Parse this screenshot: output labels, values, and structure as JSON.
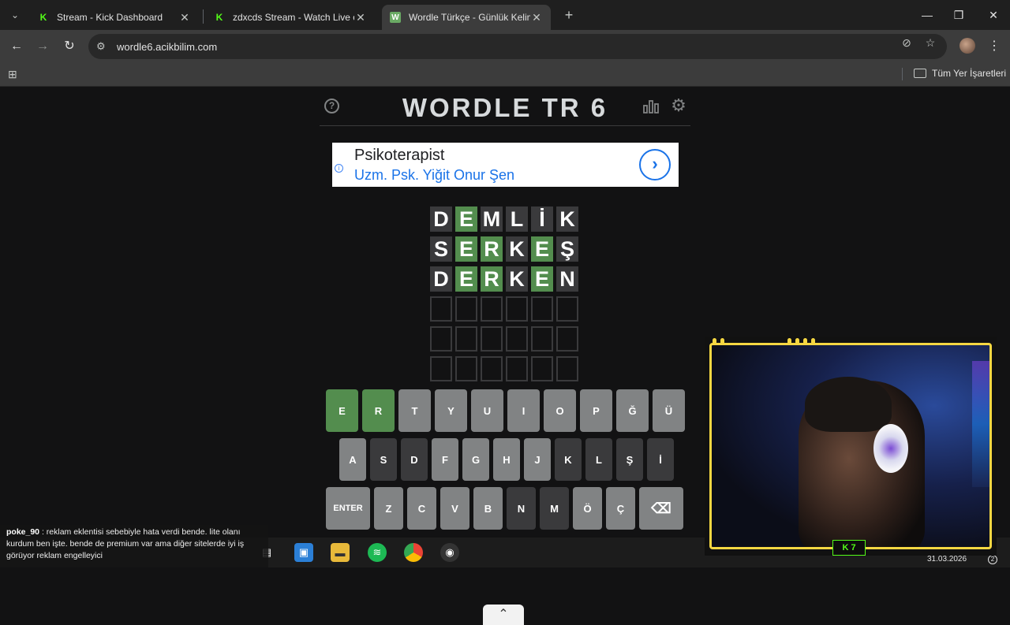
{
  "browser": {
    "tabs": [
      {
        "title": "Stream - Kick Dashboard",
        "favicon": "kick-icon",
        "active": false
      },
      {
        "title": "zdxcds Stream - Watch Live on",
        "favicon": "kick-icon",
        "active": false
      },
      {
        "title": "Wordle Türkçe - Günlük Kelime",
        "favicon": "wordle-icon",
        "active": true
      }
    ],
    "url": "wordle6.acikbilim.com",
    "bookmarks_all": "Tüm Yer İşaretleri"
  },
  "game": {
    "title": "WORDLE TR 6",
    "ad": {
      "title": "Psikoterapist",
      "subtitle": "Uzm. Psk. Yiğit Onur Şen"
    },
    "board": [
      [
        {
          "l": "D",
          "s": "absent"
        },
        {
          "l": "E",
          "s": "correct"
        },
        {
          "l": "M",
          "s": "absent"
        },
        {
          "l": "L",
          "s": "absent"
        },
        {
          "l": "İ",
          "s": "absent"
        },
        {
          "l": "K",
          "s": "absent"
        }
      ],
      [
        {
          "l": "S",
          "s": "absent"
        },
        {
          "l": "E",
          "s": "correct"
        },
        {
          "l": "R",
          "s": "correct"
        },
        {
          "l": "K",
          "s": "absent"
        },
        {
          "l": "E",
          "s": "correct"
        },
        {
          "l": "Ş",
          "s": "absent"
        }
      ],
      [
        {
          "l": "D",
          "s": "absent"
        },
        {
          "l": "E",
          "s": "correct"
        },
        {
          "l": "R",
          "s": "correct"
        },
        {
          "l": "K",
          "s": "absent"
        },
        {
          "l": "E",
          "s": "correct"
        },
        {
          "l": "N",
          "s": "absent"
        }
      ],
      [
        {
          "l": "",
          "s": "empty"
        },
        {
          "l": "",
          "s": "empty"
        },
        {
          "l": "",
          "s": "empty"
        },
        {
          "l": "",
          "s": "empty"
        },
        {
          "l": "",
          "s": "empty"
        },
        {
          "l": "",
          "s": "empty"
        }
      ],
      [
        {
          "l": "",
          "s": "empty"
        },
        {
          "l": "",
          "s": "empty"
        },
        {
          "l": "",
          "s": "empty"
        },
        {
          "l": "",
          "s": "empty"
        },
        {
          "l": "",
          "s": "empty"
        },
        {
          "l": "",
          "s": "empty"
        }
      ],
      [
        {
          "l": "",
          "s": "empty"
        },
        {
          "l": "",
          "s": "empty"
        },
        {
          "l": "",
          "s": "empty"
        },
        {
          "l": "",
          "s": "empty"
        },
        {
          "l": "",
          "s": "empty"
        },
        {
          "l": "",
          "s": "empty"
        }
      ]
    ],
    "keyboard": [
      [
        {
          "k": "E",
          "s": "correct"
        },
        {
          "k": "R",
          "s": "correct"
        },
        {
          "k": "T",
          "s": "unused"
        },
        {
          "k": "Y",
          "s": "unused"
        },
        {
          "k": "U",
          "s": "unused"
        },
        {
          "k": "I",
          "s": "unused"
        },
        {
          "k": "O",
          "s": "unused"
        },
        {
          "k": "P",
          "s": "unused"
        },
        {
          "k": "Ğ",
          "s": "unused"
        },
        {
          "k": "Ü",
          "s": "unused"
        }
      ],
      [
        {
          "k": "A",
          "s": "unused"
        },
        {
          "k": "S",
          "s": "absent"
        },
        {
          "k": "D",
          "s": "absent"
        },
        {
          "k": "F",
          "s": "unused"
        },
        {
          "k": "G",
          "s": "unused"
        },
        {
          "k": "H",
          "s": "unused"
        },
        {
          "k": "J",
          "s": "unused"
        },
        {
          "k": "K",
          "s": "absent"
        },
        {
          "k": "L",
          "s": "absent"
        },
        {
          "k": "Ş",
          "s": "absent"
        },
        {
          "k": "İ",
          "s": "absent"
        }
      ],
      [
        {
          "k": "ENTER",
          "s": "unused"
        },
        {
          "k": "Z",
          "s": "unused"
        },
        {
          "k": "C",
          "s": "unused"
        },
        {
          "k": "V",
          "s": "unused"
        },
        {
          "k": "B",
          "s": "unused"
        },
        {
          "k": "N",
          "s": "absent"
        },
        {
          "k": "M",
          "s": "absent"
        },
        {
          "k": "Ö",
          "s": "unused"
        },
        {
          "k": "Ç",
          "s": "unused"
        },
        {
          "k": "⌫",
          "s": "unused"
        }
      ]
    ],
    "colors": {
      "correct": "#538d4e",
      "absent": "#3a3a3c",
      "unused": "#818384"
    }
  },
  "chat": {
    "user": "poke_90",
    "message": "reklam eklentisi sebebiyle hata verdi bende. lite olanı kurdum ben işte. bende de premium var ama diğer sitelerde iyi iş görüyor reklam engelleyici"
  },
  "taskbar": {
    "date": "31.03.2026",
    "badge": "2"
  },
  "webcam": {
    "badge": "7"
  }
}
